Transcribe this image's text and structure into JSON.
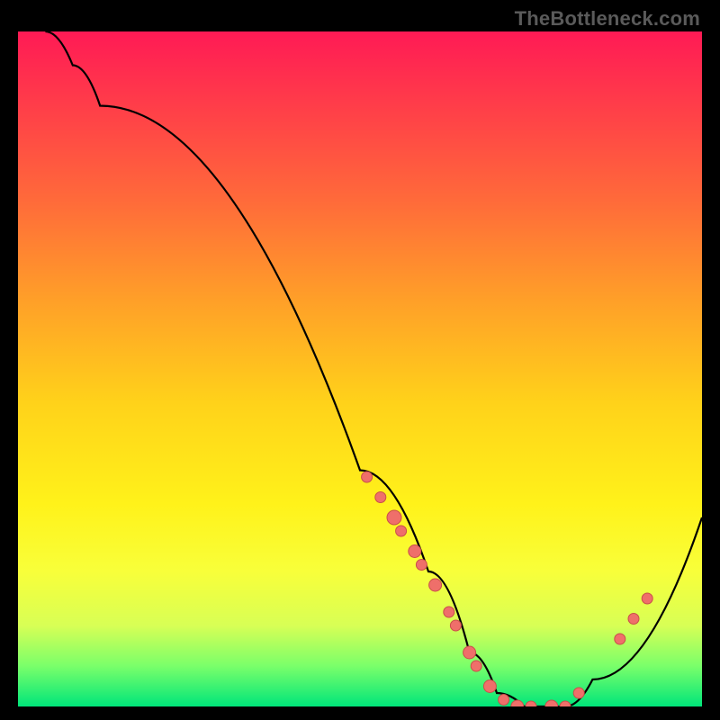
{
  "watermark": "TheBottleneck.com",
  "colors": {
    "dot_fill": "#ef6f6a",
    "dot_stroke": "#c94f4a",
    "line": "#000000"
  },
  "chart_data": {
    "type": "line",
    "title": "",
    "xlabel": "",
    "ylabel": "",
    "xlim": [
      0,
      100
    ],
    "ylim": [
      0,
      100
    ],
    "grid": false,
    "legend": false,
    "curve": [
      {
        "x": 4,
        "y": 100
      },
      {
        "x": 8,
        "y": 95
      },
      {
        "x": 12,
        "y": 89
      },
      {
        "x": 50,
        "y": 35
      },
      {
        "x": 60,
        "y": 20
      },
      {
        "x": 66,
        "y": 8
      },
      {
        "x": 70,
        "y": 2
      },
      {
        "x": 74,
        "y": 0
      },
      {
        "x": 80,
        "y": 0
      },
      {
        "x": 84,
        "y": 4
      },
      {
        "x": 100,
        "y": 28
      }
    ],
    "dot_clusters": [
      {
        "x": 51,
        "y": 34,
        "r": 6
      },
      {
        "x": 53,
        "y": 31,
        "r": 6
      },
      {
        "x": 55,
        "y": 28,
        "r": 8
      },
      {
        "x": 56,
        "y": 26,
        "r": 6
      },
      {
        "x": 58,
        "y": 23,
        "r": 7
      },
      {
        "x": 59,
        "y": 21,
        "r": 6
      },
      {
        "x": 61,
        "y": 18,
        "r": 7
      },
      {
        "x": 63,
        "y": 14,
        "r": 6
      },
      {
        "x": 64,
        "y": 12,
        "r": 6
      },
      {
        "x": 66,
        "y": 8,
        "r": 7
      },
      {
        "x": 67,
        "y": 6,
        "r": 6
      },
      {
        "x": 69,
        "y": 3,
        "r": 7
      },
      {
        "x": 71,
        "y": 1,
        "r": 6
      },
      {
        "x": 73,
        "y": 0,
        "r": 7
      },
      {
        "x": 75,
        "y": 0,
        "r": 6
      },
      {
        "x": 78,
        "y": 0,
        "r": 7
      },
      {
        "x": 80,
        "y": 0,
        "r": 6
      },
      {
        "x": 82,
        "y": 2,
        "r": 6
      },
      {
        "x": 88,
        "y": 10,
        "r": 6
      },
      {
        "x": 90,
        "y": 13,
        "r": 6
      },
      {
        "x": 92,
        "y": 16,
        "r": 6
      }
    ]
  }
}
